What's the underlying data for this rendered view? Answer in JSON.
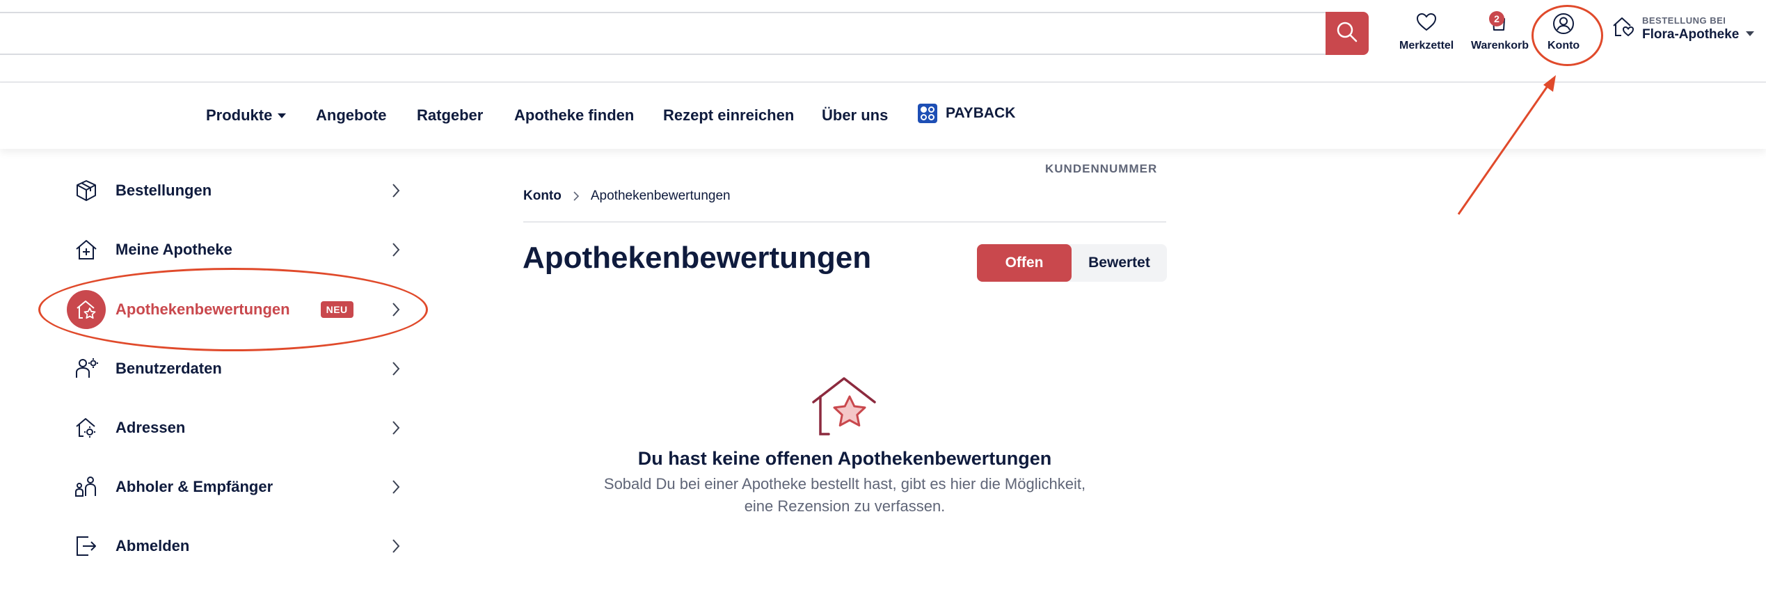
{
  "header": {
    "search": {
      "placeholder": "",
      "value": ""
    },
    "icons": [
      {
        "label": "Merkzettel",
        "icon": "heart-icon"
      },
      {
        "label": "Warenkorb",
        "icon": "cart-icon",
        "badge": "2"
      },
      {
        "label": "Konto",
        "icon": "user-icon"
      }
    ],
    "pharmacy": {
      "prefix": "BESTELLUNG BEI",
      "name": "Flora-Apotheke"
    }
  },
  "nav": {
    "items": [
      "Produkte",
      "Angebote",
      "Ratgeber",
      "Apotheke finden",
      "Rezept einreichen",
      "Über uns",
      "PAYBACK"
    ]
  },
  "sidebar": {
    "items": [
      {
        "label": "Bestellungen",
        "icon": "package-icon"
      },
      {
        "label": "Meine Apotheke",
        "icon": "pharmacy-home-icon"
      },
      {
        "label": "Apothekenbewertungen",
        "icon": "house-star-icon",
        "badge": "NEU",
        "active": true
      },
      {
        "label": "Benutzerdaten",
        "icon": "user-settings-icon"
      },
      {
        "label": "Adressen",
        "icon": "address-home-icon"
      },
      {
        "label": "Abholer & Empfänger",
        "icon": "pickup-people-icon"
      },
      {
        "label": "Abmelden",
        "icon": "logout-icon"
      }
    ]
  },
  "content": {
    "kundennummer_label": "KUNDENNUMMER",
    "breadcrumb": [
      "Konto",
      "Apothekenbewertungen"
    ],
    "title": "Apothekenbewertungen",
    "tabs": {
      "open": "Offen",
      "rated": "Bewertet",
      "active": "open"
    },
    "empty": {
      "title": "Du hast keine offenen Apothekenbewertungen",
      "subtitle": "Sobald Du bei einer Apotheke bestellt hast, gibt es hier die Möglichkeit, eine Rezension zu verfassen."
    }
  },
  "colors": {
    "accent": "#c9484d",
    "text": "#0f1b3d",
    "annotation": "#e04a2b",
    "payback": "#1e4fb5"
  }
}
